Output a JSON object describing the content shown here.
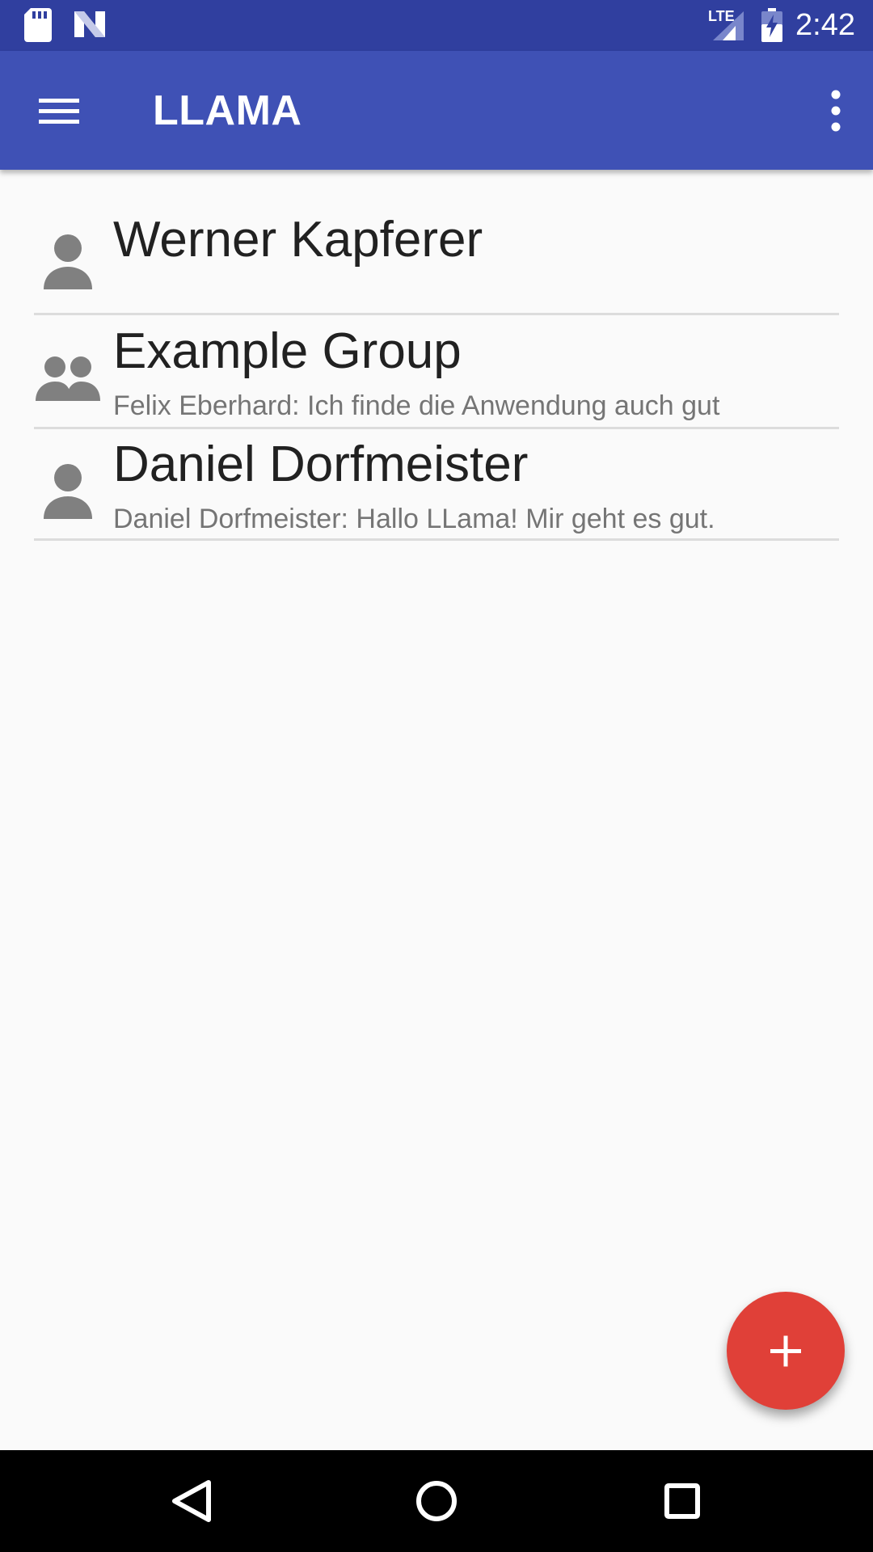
{
  "status_bar": {
    "time": "2:42",
    "network_label": "LTE",
    "icons": [
      "sd-card-icon",
      "n-notification-icon",
      "lte-signal-icon",
      "battery-charging-icon"
    ]
  },
  "app_bar": {
    "title": "LLAMA",
    "menu_icon": "hamburger-menu-icon",
    "overflow_icon": "more-vert-icon"
  },
  "conversations": [
    {
      "name": "Werner Kapferer",
      "preview": "",
      "type": "person",
      "icon": "person-icon"
    },
    {
      "name": "Example Group",
      "preview": "Felix Eberhard: Ich finde die Anwendung auch gut",
      "type": "group",
      "icon": "group-icon"
    },
    {
      "name": "Daniel Dorfmeister",
      "preview": "Daniel Dorfmeister: Hallo LLama! Mir geht es gut.",
      "type": "person",
      "icon": "person-icon"
    }
  ],
  "fab": {
    "icon": "plus-icon",
    "color": "#e04038"
  },
  "nav_bar": {
    "buttons": [
      "back-icon",
      "home-icon",
      "recents-icon"
    ]
  },
  "colors": {
    "status_bar": "#303f9f",
    "app_bar": "#3f51b5",
    "background": "#fafafa",
    "accent": "#e04038"
  }
}
